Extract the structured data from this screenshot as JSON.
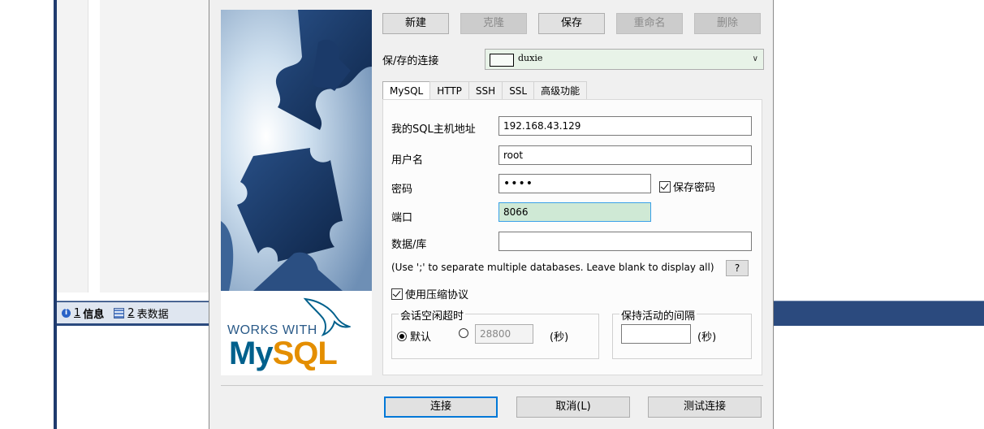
{
  "background": {
    "tabs": [
      {
        "num": "1",
        "label": "信息",
        "icon": "info-icon"
      },
      {
        "num": "2",
        "label": "表数据",
        "icon": "table-icon"
      }
    ]
  },
  "logo": {
    "works_with": "WORKS WITH",
    "brand_my": "My",
    "brand_sql": "SQL"
  },
  "toolbar": {
    "new": "新建",
    "clone": "克隆",
    "save": "保存",
    "rename": "重命名",
    "delete": "删除"
  },
  "saved_connection": {
    "label": "保/存的连接",
    "value": "duxie"
  },
  "tabs": [
    "MySQL",
    "HTTP",
    "SSH",
    "SSL",
    "高级功能"
  ],
  "form": {
    "host_label": "我的SQL主机地址",
    "host_value": "192.168.43.129",
    "user_label": "用户名",
    "user_value": "root",
    "password_label": "密码",
    "password_value": "••••",
    "save_password_label": "保存密码",
    "port_label": "端口",
    "port_value": "8066",
    "database_label": "数据/库",
    "database_value": "",
    "hint": "(Use ';' to separate multiple databases. Leave blank to display all)",
    "hint_button": "?",
    "compression_label": "使用压缩协议"
  },
  "session_timeout": {
    "title": "会话空闲超时",
    "default_label": "默认",
    "custom_value": "28800",
    "unit": "(秒)"
  },
  "keepalive": {
    "title": "保持活动的间隔",
    "value": "",
    "unit": "(秒)"
  },
  "footer": {
    "connect": "连接",
    "cancel": "取消(L)",
    "test": "测试连接"
  },
  "colors": {
    "accent": "#0078d7",
    "port_bg": "#cfe9d5",
    "bg_strip": "#2b4a7e"
  }
}
